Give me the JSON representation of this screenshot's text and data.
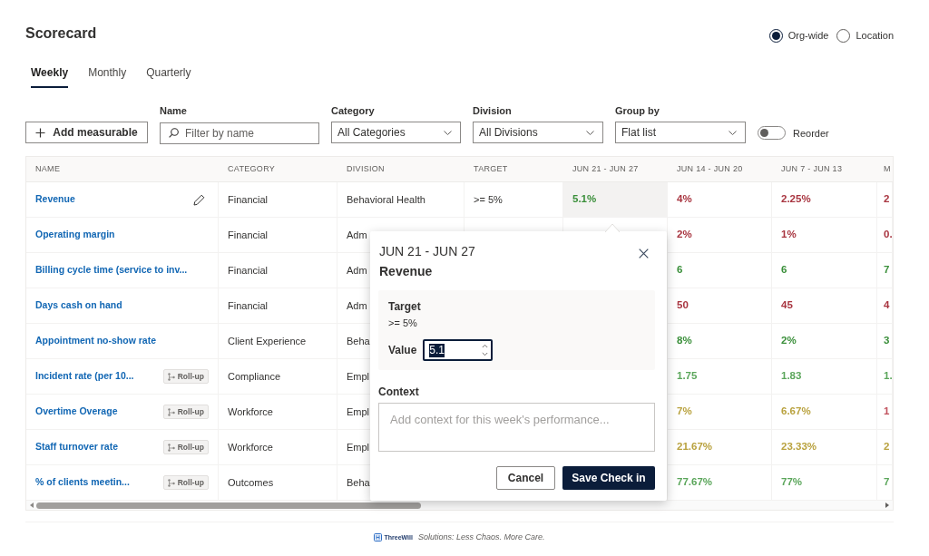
{
  "title": "Scorecard",
  "view_options": [
    {
      "label": "Org-wide",
      "selected": true
    },
    {
      "label": "Location",
      "selected": false
    }
  ],
  "tabs": [
    {
      "label": "Weekly",
      "selected": true
    },
    {
      "label": "Monthly",
      "selected": false
    },
    {
      "label": "Quarterly",
      "selected": false
    }
  ],
  "toolbar": {
    "add_button": {
      "label": "Add measurable"
    },
    "filters": [
      {
        "kind": "search",
        "label": "Name",
        "placeholder": "Filter by name"
      },
      {
        "kind": "select",
        "label": "Category",
        "value": "All Categories"
      },
      {
        "kind": "select",
        "label": "Division",
        "value": "All Divisions"
      },
      {
        "kind": "select",
        "label": "Group by",
        "value": "Flat list"
      }
    ],
    "reorder_toggle": {
      "label": "Reorder",
      "on": false
    }
  },
  "table": {
    "columns": [
      "NAME",
      "CATEGORY",
      "DIVISION",
      "TARGET",
      "JUN 21 - JUN 27",
      "JUN 14 - JUN 20",
      "JUN 7 - JUN 13",
      "M"
    ],
    "rows": [
      {
        "name": "Revenue",
        "hovered": true,
        "category": "Financial",
        "division": "Behavioral Health",
        "target": ">= 5%",
        "scores": [
          {
            "value": "5.1%",
            "color": "#3a8f3a",
            "selected": true
          },
          {
            "value": "4%",
            "color": "#a8343f",
            "selected": false
          },
          {
            "value": "2.25%",
            "color": "#a8343f",
            "selected": false
          },
          {
            "value": "2",
            "color": "#a8343f",
            "selected": false
          }
        ]
      },
      {
        "name": "Operating margin",
        "hovered": false,
        "category": "Financial",
        "division": "Adm",
        "scores": [
          {
            "value": "2%",
            "color": "#a8343f",
            "selected": false
          },
          {
            "value": "1%",
            "color": "#a8343f",
            "selected": false
          },
          {
            "value": "0.",
            "color": "#a8343f",
            "selected": false
          }
        ]
      },
      {
        "name": "Billing cycle time (service to inv...",
        "hovered": false,
        "category": "Financial",
        "division": "Adm",
        "scores": [
          {
            "value": "6",
            "color": "#3a8f3a",
            "selected": false
          },
          {
            "value": "6",
            "color": "#3a8f3a",
            "selected": false
          },
          {
            "value": "7",
            "color": "#3a8f3a",
            "selected": false
          }
        ]
      },
      {
        "name": "Days cash on hand",
        "hovered": false,
        "category": "Financial",
        "division": "Adm",
        "scores": [
          {
            "value": "50",
            "color": "#a8343f",
            "selected": false
          },
          {
            "value": "45",
            "color": "#a8343f",
            "selected": false
          },
          {
            "value": "4",
            "color": "#a8343f",
            "selected": false
          }
        ]
      },
      {
        "name": "Appointment no-show rate",
        "hovered": false,
        "category": "Client Experience",
        "division": "Beha",
        "scores": [
          {
            "value": "8%",
            "color": "#3a8f3a",
            "selected": false
          },
          {
            "value": "2%",
            "color": "#3a8f3a",
            "selected": false
          },
          {
            "value": "3",
            "color": "#3a8f3a",
            "selected": false
          }
        ]
      },
      {
        "name": "Incident rate (per 10...",
        "tag": "Roll-up",
        "hovered": false,
        "category": "Compliance",
        "division": "Empl",
        "scores": [
          {
            "value": "1.75",
            "color": "#5ba65b",
            "selected": false
          },
          {
            "value": "1.83",
            "color": "#5ba65b",
            "selected": false
          },
          {
            "value": "1.",
            "color": "#5ba65b",
            "selected": false
          }
        ]
      },
      {
        "name": "Overtime Overage",
        "tag": "Roll-up",
        "hovered": false,
        "category": "Workforce",
        "division": "Empl",
        "scores": [
          {
            "value": "7%",
            "color": "#b9a23f",
            "selected": false
          },
          {
            "value": "6.67%",
            "color": "#b9a23f",
            "selected": false
          },
          {
            "value": "1",
            "color": "#c0505c",
            "selected": false
          }
        ]
      },
      {
        "name": "Staff turnover rate",
        "tag": "Roll-up",
        "hovered": false,
        "category": "Workforce",
        "division": "Empl",
        "scores": [
          {
            "value": "21.67%",
            "color": "#b9a23f",
            "selected": false
          },
          {
            "value": "23.33%",
            "color": "#b9a23f",
            "selected": false
          },
          {
            "value": "2",
            "color": "#b9a23f",
            "selected": false
          }
        ]
      },
      {
        "name": "% of clients meetin...",
        "tag": "Roll-up",
        "hovered": false,
        "category": "Outcomes",
        "division": "Beha",
        "scores": [
          {
            "value": "77.67%",
            "color": "#5ba65b",
            "selected": false
          },
          {
            "value": "77%",
            "color": "#5ba65b",
            "selected": false
          },
          {
            "value": "7",
            "color": "#5ba65b",
            "selected": false
          }
        ]
      }
    ]
  },
  "check_in_popup": {
    "title": "JUN 21 - JUN 27",
    "subtitle": "Revenue",
    "target_label": "Target",
    "target_value": ">= 5%",
    "value_label": "Value",
    "value": "5.1",
    "value_selected": true,
    "context_label": "Context",
    "context_placeholder": "Add context for this week's performance...",
    "buttons": [
      {
        "label": "Cancel",
        "kind": "secondary"
      },
      {
        "label": "Save Check in",
        "kind": "primary"
      }
    ]
  },
  "footer": {
    "brand": "ThreeWill",
    "tagline": "Solutions: Less Chaos. More Care."
  }
}
